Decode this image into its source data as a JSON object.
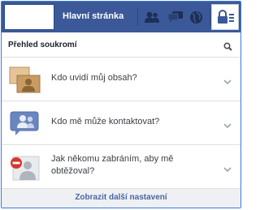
{
  "topbar": {
    "home_label": "Hlavní stránka",
    "icons": [
      "friend-requests-icon",
      "messages-icon",
      "notifications-globe-icon",
      "privacy-shortcuts-icon"
    ]
  },
  "privacy_panel": {
    "title": "Přehled soukromí",
    "items": [
      {
        "label": "Kdo uvidí můj obsah?",
        "icon": "content-visibility-icon"
      },
      {
        "label": "Kdo mě může kontaktovat?",
        "icon": "contact-icon"
      },
      {
        "label": "Jak někomu zabráním, aby mě obtěžoval?",
        "icon": "block-user-icon"
      }
    ],
    "footer_link": "Zobrazit další nastavení"
  },
  "colors": {
    "brand_blue": "#3b5998",
    "frame_border": "#3d7ad6",
    "footer_link": "#4b67a1"
  }
}
